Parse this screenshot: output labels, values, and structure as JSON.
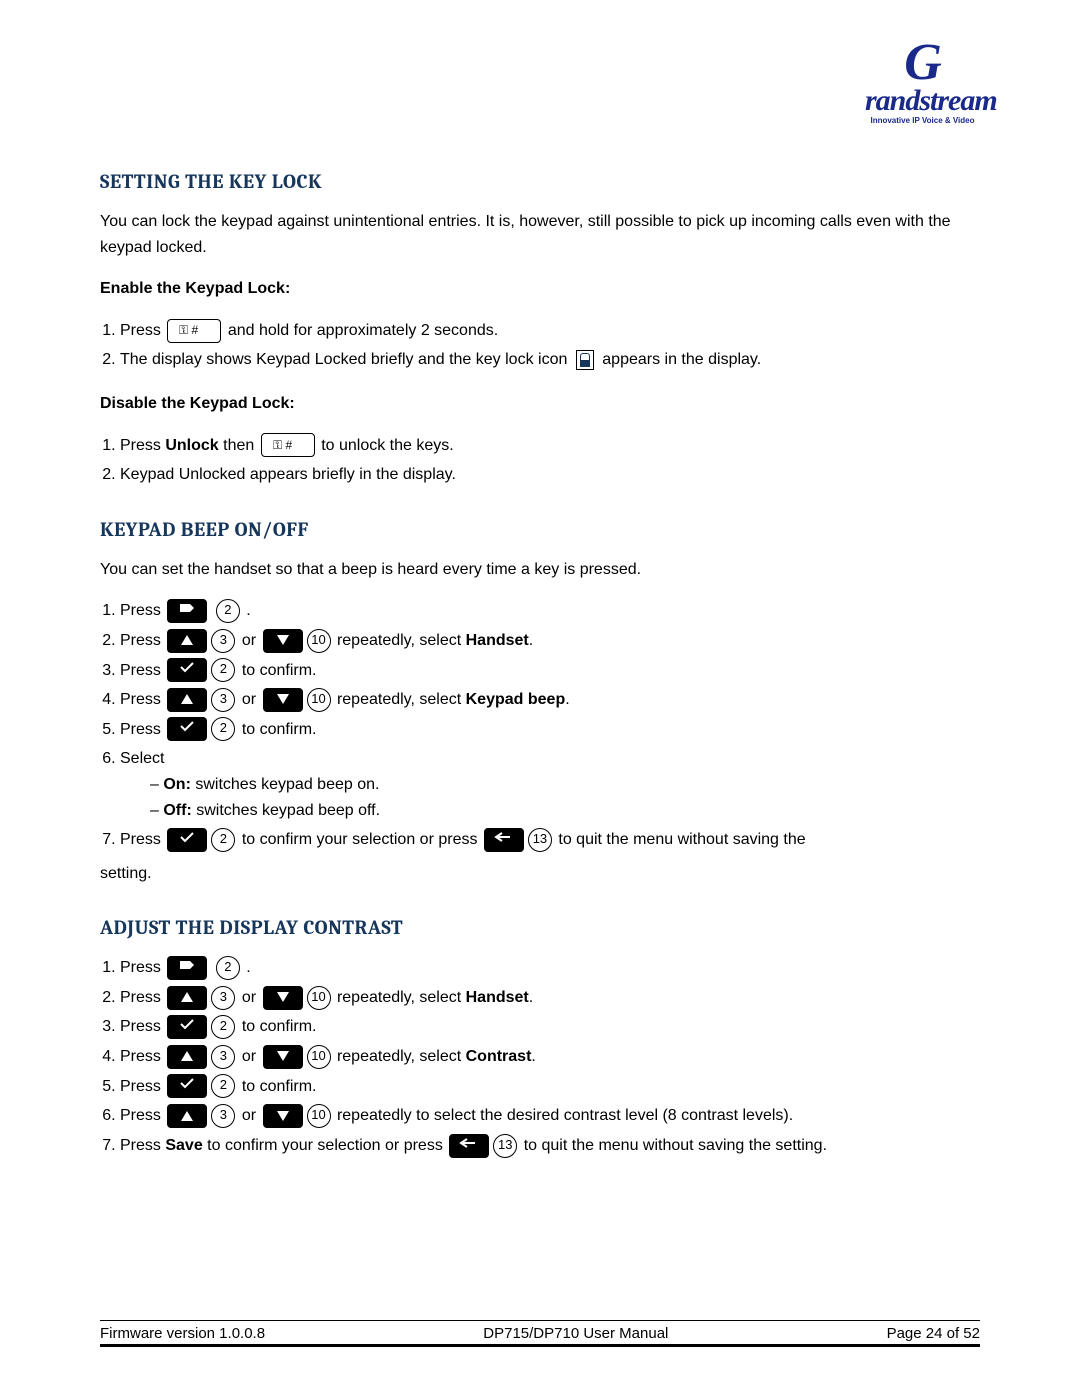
{
  "logo": {
    "brand_prefix": "G",
    "brand_rest": "randstream",
    "tagline": "Innovative IP Voice & Video"
  },
  "sections": {
    "keylock": {
      "heading": "SETTING THE KEY LOCK",
      "intro": "You can lock the keypad against unintentional entries. It is, however, still possible to pick up incoming calls even with the keypad locked.",
      "enable_label": "Enable the Keypad Lock:",
      "enable_steps": {
        "s1a": "Press",
        "s1b": "and hold for approximately 2 seconds.",
        "s2a": "The display shows Keypad Locked briefly and the key lock icon",
        "s2b": "appears in the display."
      },
      "disable_label": "Disable the Keypad Lock:",
      "disable_steps": {
        "s1a": "Press ",
        "s1_unlock": "Unlock",
        "s1b": " then",
        "s1c": "to unlock the keys.",
        "s2": "Keypad Unlocked appears briefly in the display."
      }
    },
    "beep": {
      "heading": "KEYPAD BEEP ON/OFF",
      "intro": "You can set the handset so that a beep is heard every time a key is pressed.",
      "steps": {
        "s1": "Press",
        "s1_dot": ".",
        "s2a": "Press",
        "s2_or": "or",
        "s2b": "repeatedly, select ",
        "s2_bold": "Handset",
        "s2c": ".",
        "s3a": "Press",
        "s3b": "to confirm.",
        "s4a": "Press",
        "s4_or": "or",
        "s4b": "repeatedly, select ",
        "s4_bold": "Keypad beep",
        "s4c": ".",
        "s5a": "Press",
        "s5b": "to confirm.",
        "s6": "Select",
        "s6_on_label": "On:",
        "s6_on_txt": " switches keypad beep on.",
        "s6_off_label": "Off:",
        "s6_off_txt": " switches keypad beep off.",
        "s7a": "Press",
        "s7b": "to confirm your selection or press",
        "s7c": "to quit the menu without saving the",
        "s7d": "setting."
      }
    },
    "contrast": {
      "heading": "ADJUST THE DISPLAY CONTRAST",
      "steps": {
        "s1": "Press",
        "s1_dot": ".",
        "s2a": "Press",
        "s2_or": "or",
        "s2b": "repeatedly, select ",
        "s2_bold": "Handset",
        "s2c": ".",
        "s3a": "Press",
        "s3b": "to confirm.",
        "s4a": "Press",
        "s4_or": "or",
        "s4b": "repeatedly, select ",
        "s4_bold": "Contrast",
        "s4c": ".",
        "s5a": "Press",
        "s5b": "to confirm.",
        "s6a": "Press",
        "s6_or": "or",
        "s6b": "repeatedly to select the desired contrast level (8 contrast levels).",
        "s7a": "Press ",
        "s7_save": "Save",
        "s7b": " to confirm your selection or press",
        "s7c": "to quit the menu without saving the setting."
      }
    }
  },
  "key_labels": {
    "two": "2",
    "three": "3",
    "ten": "10",
    "thirteen": "13"
  },
  "footer": {
    "left": "Firmware version 1.0.0.8",
    "center": "DP715/DP710 User Manual",
    "right": "Page 24 of 52"
  }
}
